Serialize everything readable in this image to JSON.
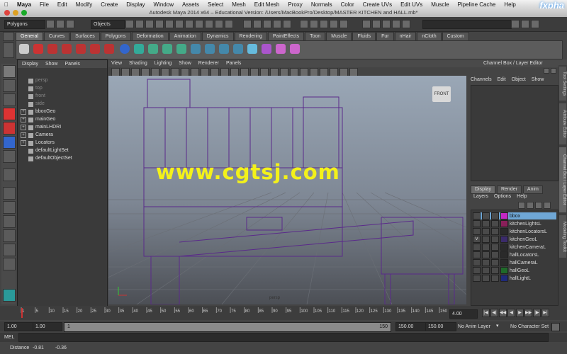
{
  "menubar": {
    "apple": "",
    "items": [
      "Maya",
      "File",
      "Edit",
      "Modify",
      "Create",
      "Display",
      "Window",
      "Assets",
      "Select",
      "Mesh",
      "Edit Mesh",
      "Proxy",
      "Normals",
      "Color",
      "Create UVs",
      "Edit UVs",
      "Muscle",
      "Pipeline Cache",
      "Help"
    ],
    "logo": "fxpha"
  },
  "window": {
    "title": "Autodesk Maya 2014 x64 – Educational Version: /Users/MacBookPro/Desktop/MASTER KITCHEN and HALL.mb*"
  },
  "statusline": {
    "mode": "Polygons",
    "select_mode": "Objects"
  },
  "shelf": {
    "tabs": [
      "General",
      "Curves",
      "Surfaces",
      "Polygons",
      "Deformation",
      "Animation",
      "Dynamics",
      "Rendering",
      "PaintEffects",
      "Toon",
      "Muscle",
      "Fluids",
      "Fur",
      "nHair",
      "nCloth",
      "Custom"
    ],
    "active": "General"
  },
  "outliner": {
    "menu": [
      "Display",
      "Show",
      "Panels"
    ],
    "items": [
      {
        "label": "persp",
        "expand": false,
        "dim": true
      },
      {
        "label": "top",
        "expand": false,
        "dim": true
      },
      {
        "label": "front",
        "expand": false,
        "dim": true
      },
      {
        "label": "side",
        "expand": false,
        "dim": true
      },
      {
        "label": "bboxGeo",
        "expand": true,
        "dim": false
      },
      {
        "label": "mainGeo",
        "expand": true,
        "dim": false
      },
      {
        "label": "mainLHDRI",
        "expand": true,
        "dim": false
      },
      {
        "label": "Camera",
        "expand": true,
        "dim": false
      },
      {
        "label": "Locators",
        "expand": true,
        "dim": false
      },
      {
        "label": "defaultLightSet",
        "expand": false,
        "dim": false
      },
      {
        "label": "defaultObjectSet",
        "expand": false,
        "dim": false
      }
    ]
  },
  "viewport": {
    "menu": [
      "View",
      "Shading",
      "Lighting",
      "Show",
      "Renderer",
      "Panels"
    ],
    "viewcube_label": "FRONT",
    "camera_label": "persp",
    "watermark": "www.cgtsj.com"
  },
  "channelbox": {
    "title": "Channel Box / Layer Editor",
    "menu": [
      "Channels",
      "Edit",
      "Object",
      "Show"
    ]
  },
  "layers": {
    "tabs": [
      "Display",
      "Render",
      "Anim"
    ],
    "active_tab": "Display",
    "menu": [
      "Layers",
      "Options",
      "Help"
    ],
    "rows": [
      {
        "name": "bbox",
        "v": "",
        "color": "#c428c4",
        "selected": true
      },
      {
        "name": "kitchenLightsL",
        "v": "",
        "color": "#8a1f5a",
        "selected": false
      },
      {
        "name": "kitchenLocatorsL",
        "v": "",
        "color": "#2a2a2a",
        "selected": false
      },
      {
        "name": "kitchenGeoL",
        "v": "V",
        "color": "#3b2b6b",
        "selected": false
      },
      {
        "name": "kitchenCameraL",
        "v": "",
        "color": "#2a2a2a",
        "selected": false
      },
      {
        "name": "hallLocatorsL",
        "v": "",
        "color": "#2a2a2a",
        "selected": false
      },
      {
        "name": "hallCameraL",
        "v": "",
        "color": "#2a2a2a",
        "selected": false
      },
      {
        "name": "hallGeoL",
        "v": "",
        "color": "#1f6a2a",
        "selected": false
      },
      {
        "name": "hallLightL",
        "v": "",
        "color": "#1f2a7a",
        "selected": false
      }
    ],
    "side_tabs": [
      "Tool Settings",
      "Attribute Editor",
      "Channel Box / Layer Editor",
      "Modeling Toolkit"
    ]
  },
  "timeline": {
    "ticks": [
      "1",
      "5",
      "10",
      "15",
      "20",
      "25",
      "30",
      "35",
      "40",
      "45",
      "50",
      "55",
      "60",
      "65",
      "70",
      "75",
      "80",
      "85",
      "90",
      "95",
      "100",
      "105",
      "110",
      "115",
      "120",
      "125",
      "130",
      "135",
      "140",
      "145",
      "150"
    ],
    "current_frame": "4.00"
  },
  "range": {
    "start": "1.00",
    "playback_start": "1.00",
    "inner_start": "1",
    "inner_end": "150",
    "playback_end": "150.00",
    "end": "150.00",
    "anim_layer": "No Anim Layer",
    "character_set": "No Character Set"
  },
  "cmdline": {
    "label": "MEL"
  },
  "helpline": {
    "label": "Distance",
    "value1": "-0.81",
    "value2": "-0.36"
  }
}
